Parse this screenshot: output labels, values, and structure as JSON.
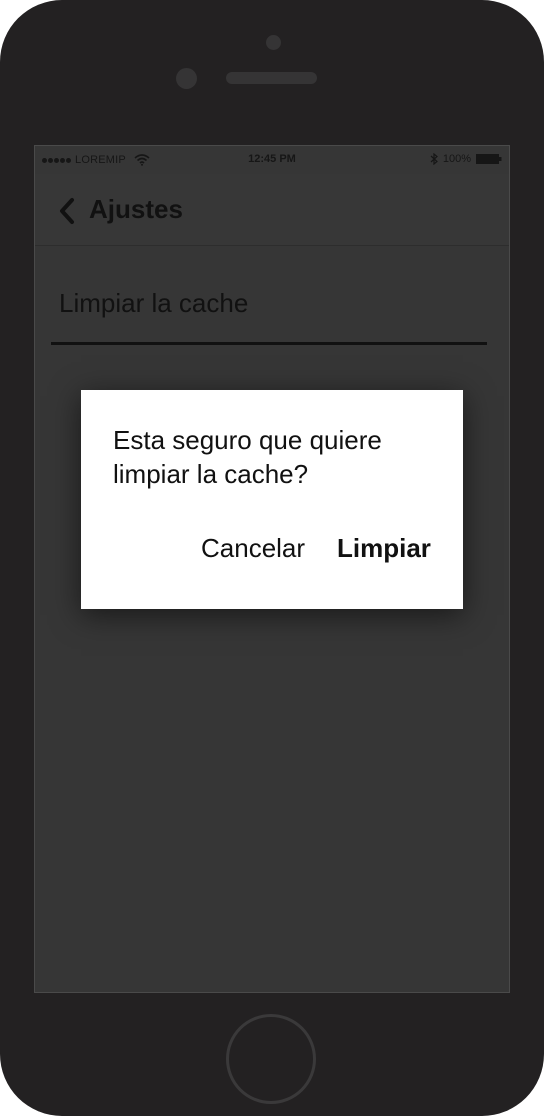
{
  "status_bar": {
    "carrier": "LOREMIP",
    "time": "12:45 PM",
    "battery": "100%"
  },
  "nav": {
    "back_icon": "chevron-left-icon",
    "title": "Ajustes"
  },
  "settings": {
    "items": [
      {
        "label": "Limpiar la cache"
      }
    ]
  },
  "dialog": {
    "message": "Esta seguro que quiere limpiar la cache?",
    "cancel_label": "Cancelar",
    "confirm_label": "Limpiar"
  },
  "colors": {
    "phone_frame": "#232122",
    "screen_background": "#363636",
    "dialog_background": "#ffffff",
    "text": "#111111"
  }
}
